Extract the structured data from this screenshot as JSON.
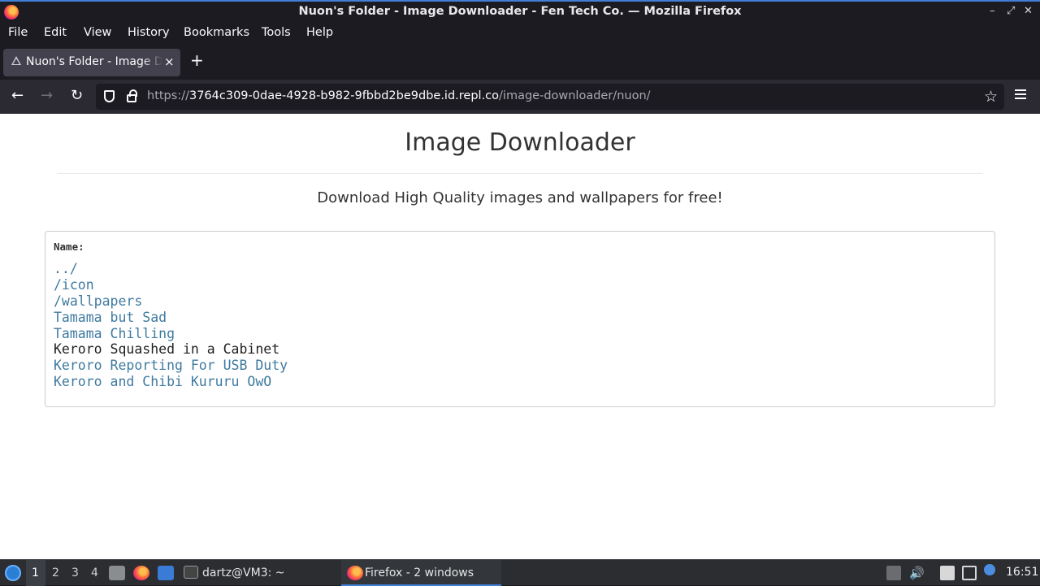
{
  "window": {
    "title": "Nuon's Folder - Image Downloader - Fen Tech Co. — Mozilla Firefox",
    "controls": {
      "minimize": "–",
      "maximize": "⤢",
      "close": "✕"
    }
  },
  "menubar": {
    "items": [
      "File",
      "Edit",
      "View",
      "History",
      "Bookmarks",
      "Tools",
      "Help"
    ]
  },
  "tabs": [
    {
      "label": "Nuon's Folder - Image Downloader - Fen Tech Co.",
      "close": "×"
    }
  ],
  "newtab_label": "+",
  "nav": {
    "back": "←",
    "forward": "→",
    "reload": "↻",
    "url_scheme": "https://",
    "url_host": "3764c309-0dae-4928-b982-9fbbd2be9dbe.id.repl.co",
    "url_path": "/image-downloader/nuon/",
    "bookmark_star": "☆"
  },
  "page": {
    "heading": "Image Downloader",
    "tagline": "Download High Quality images and wallpapers for free!",
    "listing": {
      "header": "Name:",
      "entries": [
        "../",
        "/icon",
        "/wallpapers",
        "Tamama but Sad",
        "Tamama Chilling",
        "Keroro Squashed in a Cabinet",
        "Keroro Reporting For USB Duty",
        "Keroro and Chibi Kururu OwO"
      ],
      "hovered_index": 5
    }
  },
  "taskbar": {
    "workspaces": [
      "1",
      "2",
      "3",
      "4"
    ],
    "active_workspace": "1",
    "terminal_task": "dartz@VM3: ~",
    "firefox_task": "Firefox - 2 windows",
    "clock": "16:51",
    "colors": {
      "accent": "#3f7fd6"
    }
  }
}
